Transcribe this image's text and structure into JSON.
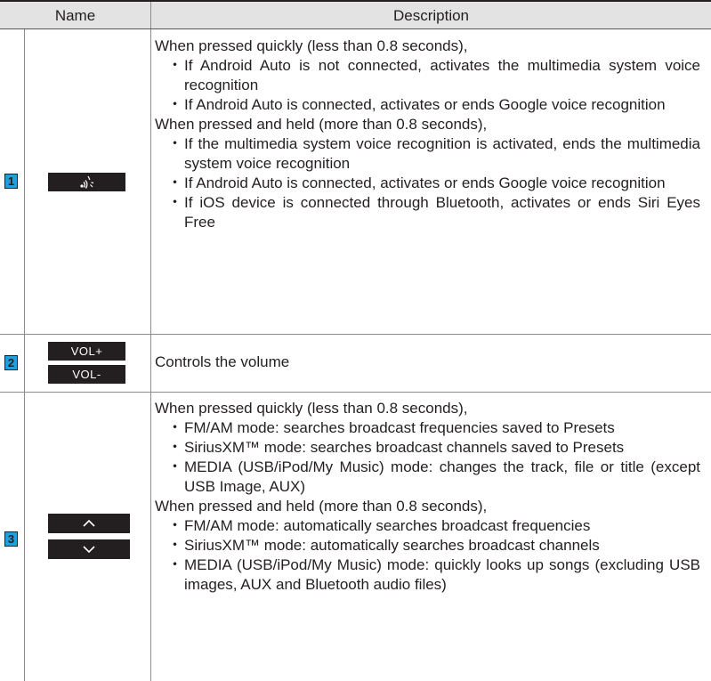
{
  "table": {
    "header": {
      "name": "Name",
      "description": "Description"
    },
    "rows": [
      {
        "number": "1",
        "button_icon": "voice-recognition-icon",
        "lines": [
          {
            "text": "When pressed quickly (less than 0.8 seconds),"
          },
          {
            "bullet": "・",
            "text": "If Android Auto is not connected, activates the multimedia system voice recognition"
          },
          {
            "bullet": "・",
            "text": "If Android Auto is connected, activates or ends Google voice recognition"
          },
          {
            "text": "When pressed and held (more than 0.8 seconds),"
          },
          {
            "bullet": "・",
            "text": "If the multimedia system voice recognition is activated, ends the multimedia system voice recognition"
          },
          {
            "bullet": "・",
            "text": "If Android Auto is connected, activates or ends Google voice recognition"
          },
          {
            "bullet": "・",
            "text": "If iOS device is connected through Bluetooth, activates or ends Siri Eyes Free"
          }
        ]
      },
      {
        "number": "2",
        "buttons": [
          "VOL+",
          "VOL-"
        ],
        "lines": [
          {
            "text": "Controls the volume"
          }
        ]
      },
      {
        "number": "3",
        "button_icons": [
          "chevron-up-icon",
          "chevron-down-icon"
        ],
        "lines": [
          {
            "text": "When pressed quickly (less than 0.8 seconds),"
          },
          {
            "bullet": "・",
            "text": "FM/AM mode: searches broadcast frequencies saved to Presets"
          },
          {
            "bullet": "・",
            "text": "SiriusXM™ mode: searches broadcast channels saved to Presets"
          },
          {
            "bullet": "・",
            "text": "MEDIA (USB/iPod/My Music) mode: changes the track, file or title (except USB Image, AUX)"
          },
          {
            "text": "When pressed and held (more than 0.8 seconds),"
          },
          {
            "bullet": "・",
            "text": "FM/AM mode: automatically searches broadcast frequencies"
          },
          {
            "bullet": "・",
            "text": "SiriusXM™ mode: automatically searches broadcast channels"
          },
          {
            "bullet": "・",
            "text": "MEDIA (USB/iPod/My Music) mode: quickly looks up songs (excluding USB images, AUX and Bluetooth audio files)"
          }
        ]
      }
    ]
  }
}
